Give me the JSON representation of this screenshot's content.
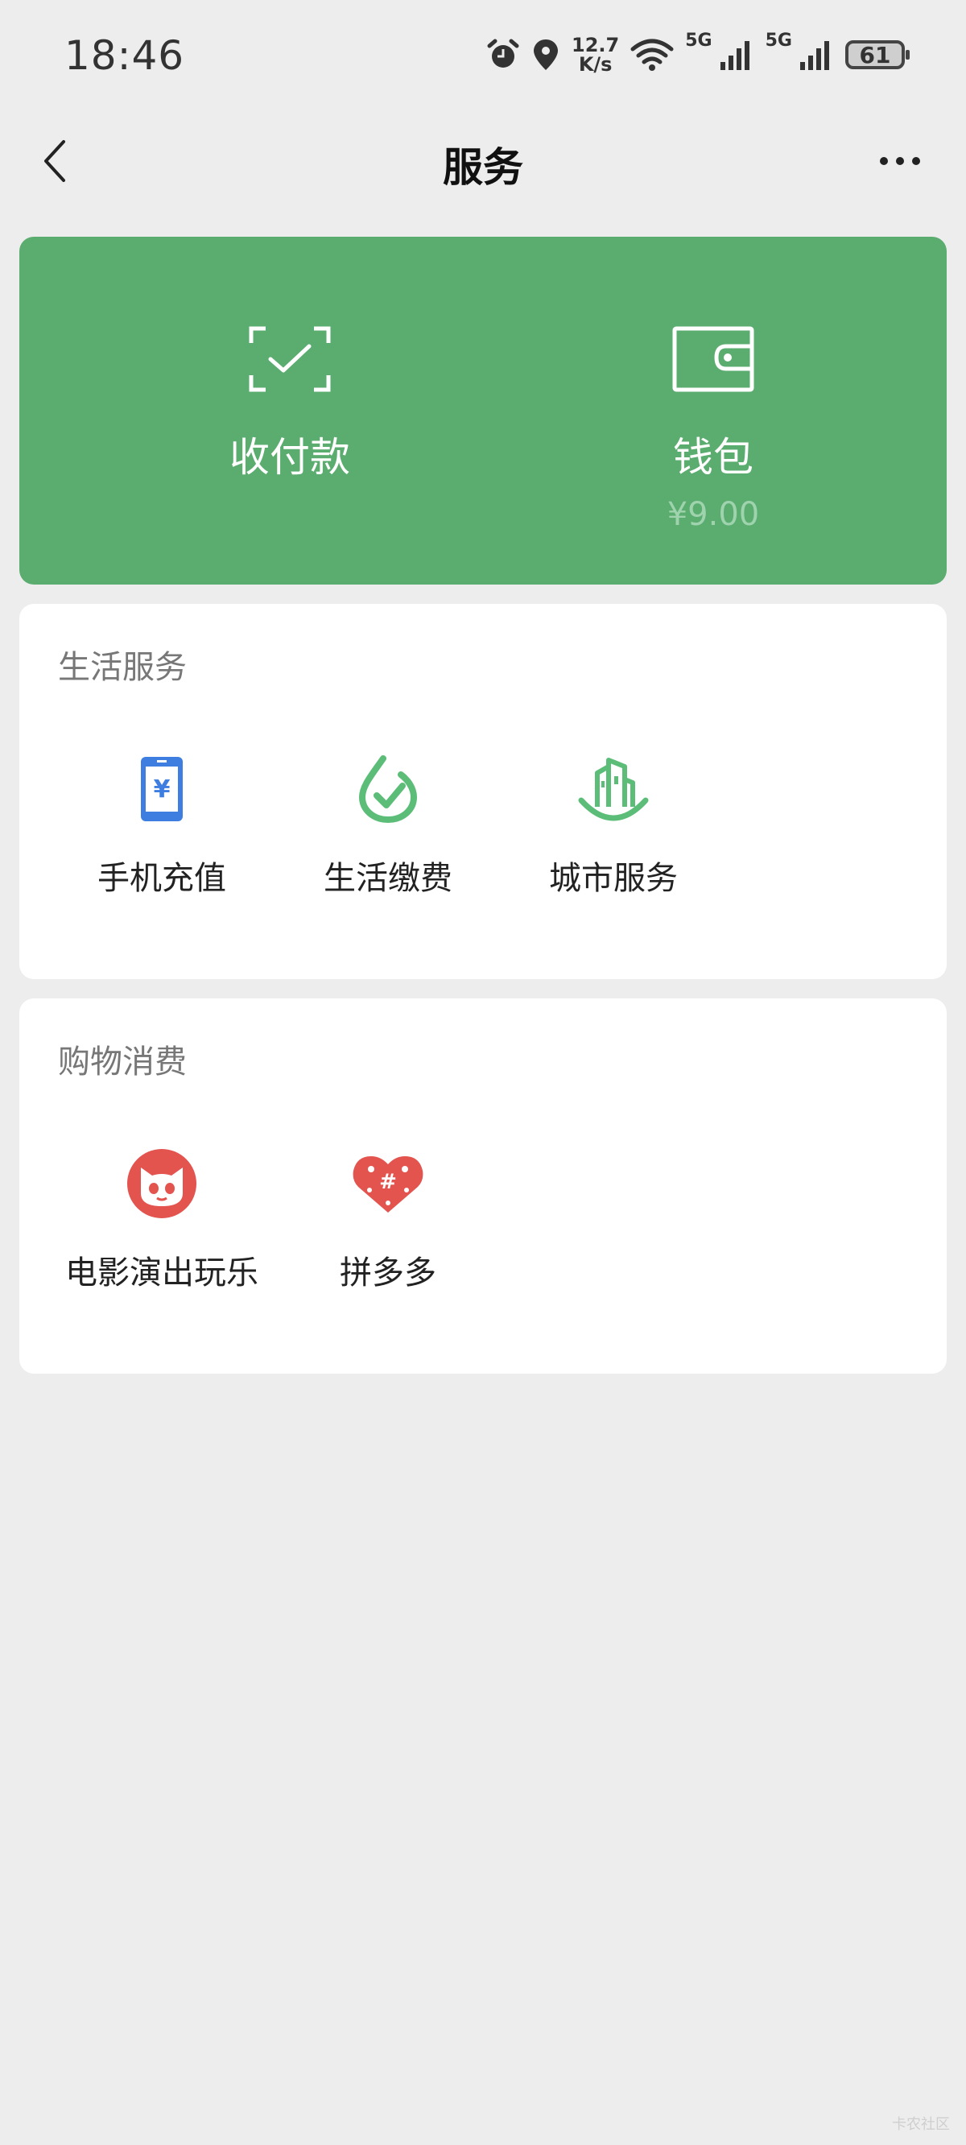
{
  "status_bar": {
    "time": "18:46",
    "speed_value": "12.7",
    "speed_unit": "K/s",
    "net1": "5G",
    "net2": "5G",
    "battery": "61"
  },
  "nav": {
    "title": "服务"
  },
  "wallet_card": {
    "pay_label": "收付款",
    "wallet_label": "钱包",
    "wallet_balance": "¥9.00"
  },
  "life_services": {
    "title": "生活服务",
    "items": [
      {
        "label": "手机充值",
        "icon": "phone-recharge-icon"
      },
      {
        "label": "生活缴费",
        "icon": "utility-payment-icon"
      },
      {
        "label": "城市服务",
        "icon": "city-service-icon"
      }
    ]
  },
  "shopping": {
    "title": "购物消费",
    "items": [
      {
        "label": "电影演出玩乐",
        "icon": "movie-cat-icon"
      },
      {
        "label": "拼多多",
        "icon": "pinduoduo-icon"
      }
    ]
  },
  "colors": {
    "green_card": "#5aac6f",
    "background": "#ededed",
    "phone_blue": "#3d7ee0",
    "service_green": "#5bbd77",
    "red": "#e3544f"
  },
  "watermark": "卡农社区"
}
